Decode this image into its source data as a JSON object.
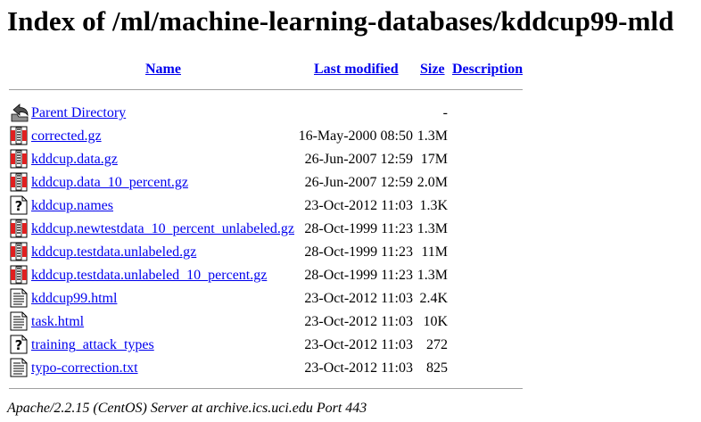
{
  "title": "Index of /ml/machine-learning-databases/kddcup99-mld",
  "columns": {
    "name": "Name",
    "last_modified": "Last modified",
    "size": "Size",
    "description": "Description"
  },
  "parent": {
    "name": "Parent Directory",
    "size": "-",
    "icon": "back-icon"
  },
  "files": [
    {
      "name": "corrected.gz",
      "modified": "16-May-2000 08:50",
      "size": "1.3M",
      "icon": "compressed-icon"
    },
    {
      "name": "kddcup.data.gz",
      "modified": "26-Jun-2007 12:59",
      "size": "17M",
      "icon": "compressed-icon"
    },
    {
      "name": "kddcup.data_10_percent.gz",
      "modified": "26-Jun-2007 12:59",
      "size": "2.0M",
      "icon": "compressed-icon"
    },
    {
      "name": "kddcup.names",
      "modified": "23-Oct-2012 11:03",
      "size": "1.3K",
      "icon": "unknown-icon"
    },
    {
      "name": "kddcup.newtestdata_10_percent_unlabeled.gz",
      "modified": "28-Oct-1999 11:23",
      "size": "1.3M",
      "icon": "compressed-icon"
    },
    {
      "name": "kddcup.testdata.unlabeled.gz",
      "modified": "28-Oct-1999 11:23",
      "size": "11M",
      "icon": "compressed-icon"
    },
    {
      "name": "kddcup.testdata.unlabeled_10_percent.gz",
      "modified": "28-Oct-1999 11:23",
      "size": "1.3M",
      "icon": "compressed-icon"
    },
    {
      "name": "kddcup99.html",
      "modified": "23-Oct-2012 11:03",
      "size": "2.4K",
      "icon": "text-icon"
    },
    {
      "name": "task.html",
      "modified": "23-Oct-2012 11:03",
      "size": "10K",
      "icon": "text-icon"
    },
    {
      "name": "training_attack_types",
      "modified": "23-Oct-2012 11:03",
      "size": "272",
      "icon": "unknown-icon"
    },
    {
      "name": "typo-correction.txt",
      "modified": "23-Oct-2012 11:03",
      "size": "825",
      "icon": "text-icon"
    }
  ],
  "footer": "Apache/2.2.15 (CentOS) Server at archive.ics.uci.edu Port 443"
}
